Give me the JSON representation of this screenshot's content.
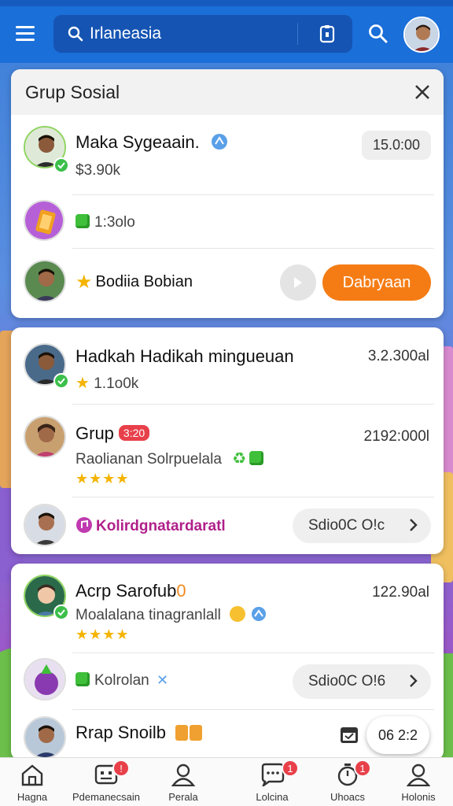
{
  "search": {
    "value": "Irlaneasia"
  },
  "card1": {
    "title": "Grup Sosial",
    "rows": [
      {
        "name": "Maka Sygeaain.",
        "sub": "$3.90k",
        "time": "15.0:00"
      },
      {
        "sub": "1:3olo"
      },
      {
        "name": "Bodiia Bobian",
        "action": "Dabryaan"
      }
    ]
  },
  "card2": {
    "rows": [
      {
        "name": "Hadkah Hadikah mingueuan",
        "sub": "1.1o0k",
        "time": "3.2.300al"
      },
      {
        "name": "Grup",
        "badge": "3:20",
        "sub": "Raolianan Solrpuelala",
        "time": "2192:000l"
      },
      {
        "name": "Kolirdgnatardaratl",
        "pill": "Sdio0C O!c"
      }
    ]
  },
  "card3": {
    "rows": [
      {
        "name": "Acrp Sarofub",
        "name_suffix": "0",
        "sub": "Moalalana tinagranlall",
        "time": "122.90al"
      },
      {
        "sub": "Kolrolan",
        "pill": "Sdio0C O!6"
      },
      {
        "name": "Rrap Snoilb"
      }
    ]
  },
  "float_chip": {
    "label": "06 2:2"
  },
  "bottom_nav": [
    {
      "label": "Hagna",
      "badge": ""
    },
    {
      "label": "Pdemanecsain",
      "badge": "!"
    },
    {
      "label": "Perala",
      "badge": ""
    },
    {
      "label": "Lolcina",
      "badge": "1"
    },
    {
      "label": "Uhoacs",
      "badge": "1"
    },
    {
      "label": "Holonis",
      "badge": ""
    }
  ],
  "colors": {
    "topbar": "#1a6fd9",
    "accent_orange": "#f57c15",
    "verified_green": "#3bbf4a",
    "badge_red": "#e8404a"
  }
}
